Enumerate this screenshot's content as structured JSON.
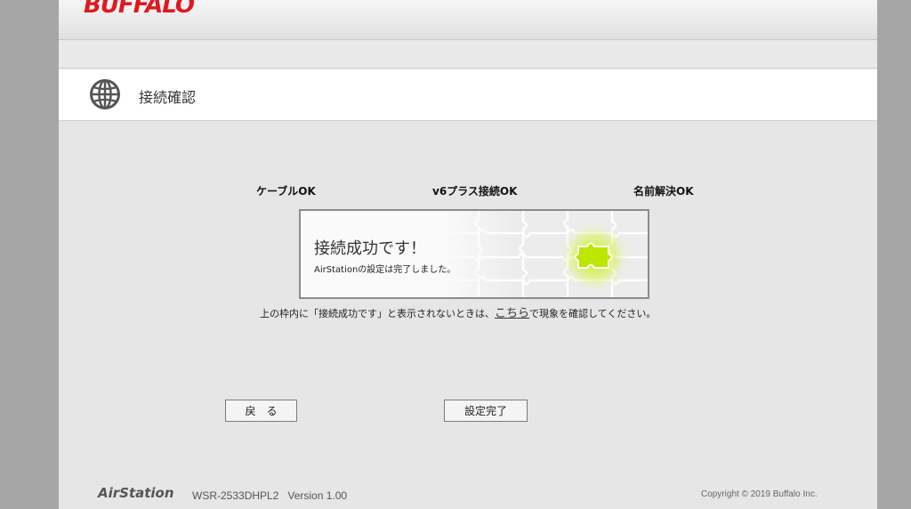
{
  "header": {
    "logo_text": "BUFFALO"
  },
  "page": {
    "title": "接続確認",
    "icon": "globe-icon"
  },
  "status": {
    "cable": "ケーブルOK",
    "v6plus": "v6プラス接続OK",
    "dns": "名前解決OK"
  },
  "result": {
    "title": "接続成功です！",
    "subtitle": "AirStationの設定は完了しました。",
    "highlight_color": "#b5e000"
  },
  "note": {
    "before": "上の枠内に「接続成功です」と表示されないときは、",
    "link": "こちら",
    "after": "で現象を確認してください。"
  },
  "buttons": {
    "back": "戻　る",
    "finish": "設定完了"
  },
  "footer": {
    "brand": "AirStation",
    "model": "WSR-2533DHPL2   Version 1.00",
    "copyright": "Copyright © 2019 Buffalo Inc."
  },
  "colors": {
    "brand_red": "#e0191e",
    "background": "#e6e6e6"
  }
}
